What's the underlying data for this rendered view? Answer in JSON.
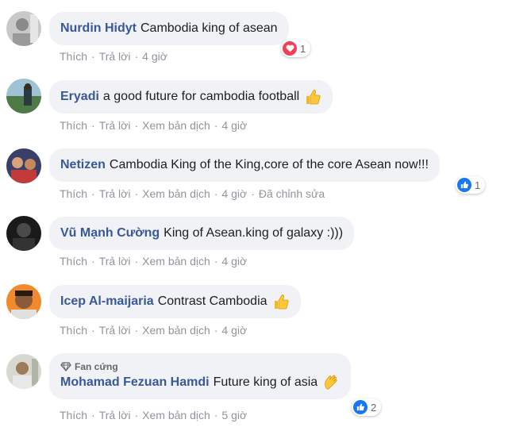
{
  "actions": {
    "like": "Thích",
    "reply": "Trả lời",
    "translate": "Xem bản dịch",
    "edited": "Đã chỉnh sửa",
    "sep": "·"
  },
  "comments": [
    {
      "name": "Nurdin Hidyt",
      "text": "Cambodia king of asean",
      "time": "4 giờ",
      "reaction": {
        "type": "heart",
        "count": "1"
      }
    },
    {
      "name": "Eryadi",
      "text": "a good future for cambodia football",
      "time": "4 giờ",
      "emoji": "thumbs-up"
    },
    {
      "name": "Netizen",
      "text": "Cambodia King of the King,core of the core Asean now!!!",
      "time": "4 giờ",
      "reaction": {
        "type": "like",
        "count": "1"
      }
    },
    {
      "name": "Vũ Mạnh Cường",
      "text": "King of Asean.king of galaxy :)))",
      "time": "4 giờ"
    },
    {
      "name": "Icep Al-maijaria",
      "text": "Contrast Cambodia",
      "time": "4 giờ",
      "emoji": "thumbs-up"
    },
    {
      "name": "Mohamad Fezuan Hamdi",
      "badge": "Fan cứng",
      "text": "Future king of asia",
      "time": "5 giờ",
      "emoji": "clap",
      "reaction": {
        "type": "like",
        "count": "2"
      }
    }
  ],
  "colors": {
    "name": "#385898",
    "bubble": "#f0f2f5",
    "meta": "#90949c",
    "like": "#1877f2",
    "heart": "#f33e58"
  }
}
